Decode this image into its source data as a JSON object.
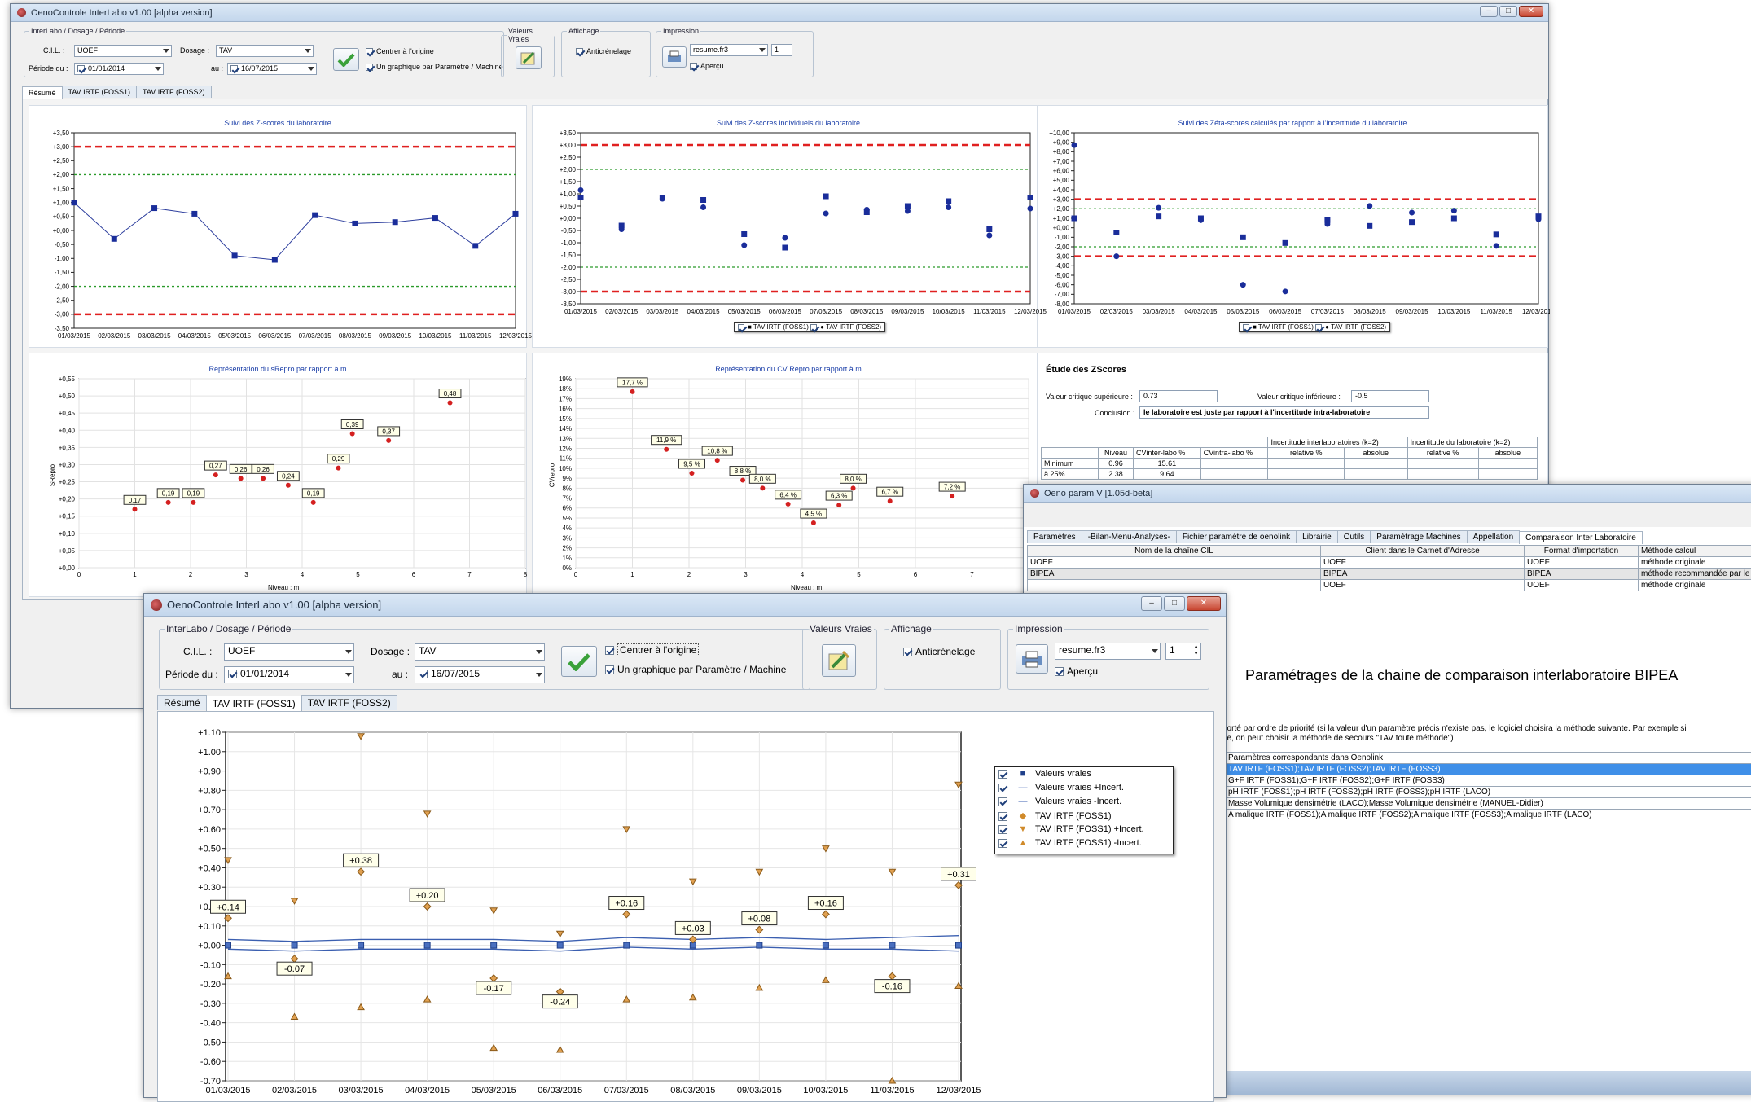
{
  "back_window": {
    "title": "OenoControle InterLabo v1.00 [alpha version]",
    "group_interlabo": "InterLabo / Dosage / Période",
    "cil_label": "C.I.L. :",
    "cil_value": "UOEF",
    "dosage_label": "Dosage :",
    "dosage_value": "TAV",
    "periode_label": "Période du :",
    "periode_from": "01/01/2014",
    "au_label": "au :",
    "periode_to": "16/07/2015",
    "centrer": "Centrer à l'origine",
    "un_graphique": "Un graphique par Paramètre / Machine",
    "valeurs_vraies": "Valeurs Vraies",
    "affichage": "Affichage",
    "anticrenelage": "Anticrénelage",
    "impression": "Impression",
    "report": "resume.fr3",
    "copies": "1",
    "apercu": "Aperçu",
    "tabs": [
      "Résumé",
      "TAV IRTF (FOSS1)",
      "TAV IRTF (FOSS2)"
    ],
    "chart1_title": "Suivi des Z-scores du laboratoire",
    "chart2_title": "Suivi des Z-scores individuels du laboratoire",
    "chart3_title": "Suivi des Zéta-scores calculés par rapport à l'incertitude du laboratoire",
    "chart4_title": "Représentation du sRepro par rapport à m",
    "chart5_title": "Représentation du CV Repro par rapport à m",
    "legend_foss1": "TAV IRTF (FOSS1)",
    "legend_foss2": "TAV IRTF (FOSS2)",
    "chart4_ylabel": "SRepro",
    "chart5_ylabel": "CVrepro",
    "niveau_label": "Niveau : m",
    "etude_title": "Étude des ZScores",
    "vcs_label": "Valeur critique supérieure :",
    "vcs_value": "0.73",
    "vci_label": "Valeur critique inférieure :",
    "vci_value": "-0.5",
    "conclusion_label": "Conclusion :",
    "conclusion_value": "le laboratoire est juste par rapport à l'incertitude intra-laboratoire",
    "table_headers_top": [
      "Incertitude interlaboratoires (k=2)",
      "Incertitude du laboratoire (k=2)"
    ],
    "table_headers": [
      "Niveau",
      "CVinter-labo %",
      "CVintra-labo %",
      "relative %",
      "absolue",
      "relative %",
      "absolue"
    ],
    "table_rows": [
      [
        "Minimum",
        "0.96",
        "15.61"
      ],
      [
        "à 25%",
        "2.38",
        "9.64"
      ]
    ]
  },
  "param_window": {
    "title": "Oeno param V [1.05d-beta]",
    "tabs": [
      "Paramètres",
      "-Bilan-Menu-Analyses-",
      "Fichier paramètre de oenolink",
      "Librairie",
      "Outils",
      "Paramétrage Machines",
      "Appellation",
      "Comparaison Inter Laboratoire"
    ],
    "columns": [
      "Nom de la chaîne CIL",
      "Client dans le Carnet d'Adresse",
      "Format d'importation",
      "Méthode calcul"
    ],
    "rows": [
      [
        "UOEF",
        "UOEF",
        "UOEF",
        "méthode originale"
      ],
      [
        "BIPEA",
        "BIPEA",
        "BIPEA",
        "méthode recommandée par le"
      ],
      [
        "",
        "UOEF",
        "UOEF",
        "méthode originale"
      ]
    ],
    "heading": "Paramétrages de la chaine de comparaison interlaboratoire BIPEA",
    "k_text": "k",
    "desc1": "porté par ordre de priorité (si la valeur d'un paramètre précis n'existe pas, le logiciel choisira la méthode suivante. Par exemple si",
    "desc2": "he, on peut choisir la méthode de secours \"TAV toute méthode\")",
    "params_header": "Paramètres correspondants dans Oenolink",
    "params": [
      "TAV IRTF (FOSS1);TAV IRTF (FOSS2);TAV IRTF (FOSS3)",
      "G+F IRTF (FOSS1);G+F IRTF (FOSS2);G+F IRTF (FOSS3)",
      "pH IRTF (FOSS1);pH IRTF (FOSS2);pH IRTF (FOSS3);pH IRTF (LACO)",
      "Masse Volumique densimétrie (LACO);Masse Volumique densimétrie (MANUEL-Didier)",
      "A malique IRTF (FOSS1);A malique IRTF (FOSS2);A malique IRTF (FOSS3);A malique IRTF (LACO)"
    ]
  },
  "front_window": {
    "title": "OenoControle InterLabo v1.00 [alpha version]",
    "group_interlabo": "InterLabo / Dosage / Période",
    "cil_label": "C.I.L. :",
    "cil_value": "UOEF",
    "dosage_label": "Dosage :",
    "dosage_value": "TAV",
    "periode_label": "Période du :",
    "periode_from": "01/01/2014",
    "au_label": "au :",
    "periode_to": "16/07/2015",
    "centrer": "Centrer à l'origine",
    "un_graphique": "Un graphique par Paramètre / Machine",
    "valeurs_vraies": "Valeurs Vraies",
    "affichage": "Affichage",
    "anticrenelage": "Anticrénelage",
    "impression": "Impression",
    "report": "resume.fr3",
    "copies": "1",
    "apercu": "Aperçu",
    "tabs": [
      "Résumé",
      "TAV IRTF (FOSS1)",
      "TAV IRTF (FOSS2)"
    ],
    "legend": [
      "Valeurs vraies",
      "Valeurs vraies +Incert.",
      "Valeurs vraies -Incert.",
      "TAV IRTF (FOSS1)",
      "TAV IRTF (FOSS1) +Incert.",
      "TAV IRTF (FOSS1) -Incert."
    ]
  },
  "chart_data": [
    {
      "type": "line",
      "title": "Suivi des Z-scores du laboratoire",
      "categories": [
        "01/03/2015",
        "02/03/2015",
        "03/03/2015",
        "04/03/2015",
        "05/03/2015",
        "06/03/2015",
        "07/03/2015",
        "08/03/2015",
        "09/03/2015",
        "10/03/2015",
        "11/03/2015",
        "12/03/2015"
      ],
      "values": [
        1.0,
        -0.3,
        0.8,
        0.6,
        -0.9,
        -1.05,
        0.55,
        0.25,
        0.3,
        0.45,
        -0.55,
        0.6
      ],
      "ylim": [
        -3.5,
        3.5
      ],
      "yticks": [
        "+3,50",
        "+3,00",
        "+2,50",
        "+2,00",
        "+1,50",
        "+1,00",
        "+0,50",
        "+0,00",
        "-0,50",
        "-1,00",
        "-1,50",
        "-2,00",
        "-2,50",
        "-3,00",
        "-3,50"
      ],
      "red_lines": [
        3,
        -3
      ],
      "green_lines": [
        2,
        -2
      ]
    },
    {
      "type": "scatter",
      "title": "Suivi des Z-scores individuels du laboratoire",
      "categories": [
        "01/03/2015",
        "02/03/2015",
        "03/03/2015",
        "04/03/2015",
        "05/03/2015",
        "06/03/2015",
        "07/03/2015",
        "08/03/2015",
        "09/03/2015",
        "10/03/2015",
        "11/03/2015",
        "12/03/2015"
      ],
      "series": [
        {
          "name": "TAV IRTF (FOSS1)",
          "values": [
            0.85,
            -0.3,
            0.85,
            0.75,
            -0.65,
            -1.2,
            0.9,
            0.25,
            0.5,
            0.7,
            -0.45,
            0.85
          ]
        },
        {
          "name": "TAV IRTF (FOSS2)",
          "values": [
            1.15,
            -0.45,
            0.8,
            0.45,
            -1.1,
            -0.8,
            0.2,
            0.35,
            0.3,
            0.45,
            -0.7,
            0.4
          ]
        }
      ],
      "ylim": [
        -3.5,
        3.5
      ],
      "yticks": [
        "+3,50",
        "+3,00",
        "+2,50",
        "+2,00",
        "+1,50",
        "+1,00",
        "+0,50",
        "+0,00",
        "-0,50",
        "-1,00",
        "-1,50",
        "-2,00",
        "-2,50",
        "-3,00",
        "-3,50"
      ],
      "red_lines": [
        3,
        -3
      ],
      "green_lines": [
        2,
        -2
      ]
    },
    {
      "type": "scatter",
      "title": "Suivi des Zéta-scores calculés par rapport à l'incertitude du laboratoire",
      "categories": [
        "01/03/2015",
        "02/03/2015",
        "03/03/2015",
        "04/03/2015",
        "05/03/2015",
        "06/03/2015",
        "07/03/2015",
        "08/03/2015",
        "09/03/2015",
        "10/03/2015",
        "11/03/2015",
        "12/03/2015"
      ],
      "series": [
        {
          "name": "TAV IRTF (FOSS1)",
          "values": [
            1.0,
            -0.5,
            1.2,
            1.0,
            -1.0,
            -1.6,
            0.8,
            0.2,
            0.6,
            1.0,
            -0.7,
            1.2
          ]
        },
        {
          "name": "TAV IRTF (FOSS2)",
          "values": [
            8.7,
            -3.0,
            2.1,
            0.8,
            -6.0,
            -6.7,
            0.4,
            2.3,
            1.6,
            1.8,
            -1.9,
            0.9
          ]
        }
      ],
      "ylim": [
        -8,
        10
      ],
      "yticks": [
        "+10,00",
        "+9,00",
        "+8,00",
        "+7,00",
        "+6,00",
        "+5,00",
        "+4,00",
        "+3,00",
        "+2,00",
        "+1,00",
        "+0,00",
        "-1,00",
        "-2,00",
        "-3,00",
        "-4,00",
        "-5,00",
        "-6,00",
        "-7,00",
        "-8,00"
      ],
      "red_lines": [
        3,
        -3
      ],
      "green_lines": [
        2,
        -2
      ]
    },
    {
      "type": "scatter",
      "title": "Représentation du sRepro par rapport à m",
      "x": [
        1,
        1.6,
        2.05,
        2.45,
        2.9,
        3.3,
        3.75,
        4.2,
        4.65,
        4.9,
        5.55,
        6.65
      ],
      "y": [
        0.17,
        0.19,
        0.19,
        0.27,
        0.26,
        0.26,
        0.24,
        0.19,
        0.29,
        0.39,
        0.37,
        0.48
      ],
      "labels": [
        "0,17",
        "0,19",
        "0,19",
        "0,27",
        "0,26",
        "0,26",
        "0,24",
        "0,19",
        "0,29",
        "0,39",
        "0,37",
        "0,48"
      ],
      "xlim": [
        0,
        8
      ],
      "ylim": [
        0,
        0.55
      ],
      "xlabel": "Niveau : m",
      "ylabel": "SRepro"
    },
    {
      "type": "scatter",
      "title": "Représentation du CV Repro par rapport à m",
      "x": [
        1,
        1.6,
        2.05,
        2.5,
        2.95,
        3.3,
        3.75,
        4.2,
        4.65,
        4.9,
        5.55,
        6.65
      ],
      "y": [
        17.7,
        11.9,
        9.5,
        10.8,
        8.8,
        8.0,
        6.4,
        4.5,
        6.3,
        8.0,
        6.7,
        7.2
      ],
      "labels": [
        "17,7 %",
        "11,9 %",
        "9,5 %",
        "10,8 %",
        "8,8 %",
        "8,0 %",
        "6,4 %",
        "4,5 %",
        "6,3 %",
        "8,0 %",
        "6,7 %",
        "7,2 %"
      ],
      "xlim": [
        0,
        8
      ],
      "ylim": [
        0,
        19
      ],
      "xlabel": "Niveau : m",
      "ylabel": "CVrepro"
    },
    {
      "type": "scatter",
      "title": "",
      "categories": [
        "01/03/2015",
        "02/03/2015",
        "03/03/2015",
        "04/03/2015",
        "05/03/2015",
        "06/03/2015",
        "07/03/2015",
        "08/03/2015",
        "09/03/2015",
        "10/03/2015",
        "11/03/2015",
        "12/03/2015"
      ],
      "series": [
        {
          "name": "Valeurs vraies",
          "values": [
            0,
            0,
            0,
            0,
            0,
            0,
            0,
            0,
            0,
            0,
            0,
            0
          ]
        },
        {
          "name": "Valeurs vraies +Incert.",
          "values": [
            0.03,
            0.02,
            0.03,
            0.03,
            0.03,
            0.02,
            0.04,
            0.03,
            0.04,
            0.03,
            0.04,
            0.05
          ]
        },
        {
          "name": "Valeurs vraies -Incert.",
          "values": [
            -0.02,
            -0.03,
            -0.02,
            -0.02,
            -0.02,
            -0.03,
            -0.01,
            -0.02,
            -0.01,
            -0.02,
            -0.02,
            -0.03
          ]
        },
        {
          "name": "TAV IRTF (FOSS1)",
          "values": [
            0.14,
            -0.07,
            0.38,
            0.2,
            -0.17,
            -0.24,
            0.16,
            0.03,
            0.08,
            0.16,
            -0.16,
            0.31
          ]
        },
        {
          "name": "TAV IRTF (FOSS1) +Incert.",
          "values": [
            0.44,
            0.23,
            1.08,
            0.68,
            0.18,
            0.06,
            0.6,
            0.33,
            0.38,
            0.5,
            0.38,
            0.83
          ]
        },
        {
          "name": "TAV IRTF (FOSS1) -Incert.",
          "values": [
            -0.16,
            -0.37,
            -0.32,
            -0.28,
            -0.53,
            -0.54,
            -0.28,
            -0.27,
            -0.22,
            -0.18,
            -0.7,
            -0.21
          ]
        }
      ],
      "data_labels": [
        "+0.14",
        "-0.07",
        "+0.38",
        "+0.20",
        "-0.17",
        "-0.24",
        "+0.16",
        "+0.03",
        "+0.08",
        "+0.16",
        "-0.16",
        "+0.31"
      ],
      "ylim": [
        -0.7,
        1.1
      ],
      "yticks": [
        "+1.10",
        "+1.00",
        "+0.90",
        "+0.80",
        "+0.70",
        "+0.60",
        "+0.50",
        "+0.40",
        "+0.30",
        "+0.20",
        "+0.10",
        "+0.00",
        "-0.10",
        "-0.20",
        "-0.30",
        "-0.40",
        "-0.50",
        "-0.60",
        "-0.70"
      ]
    }
  ]
}
